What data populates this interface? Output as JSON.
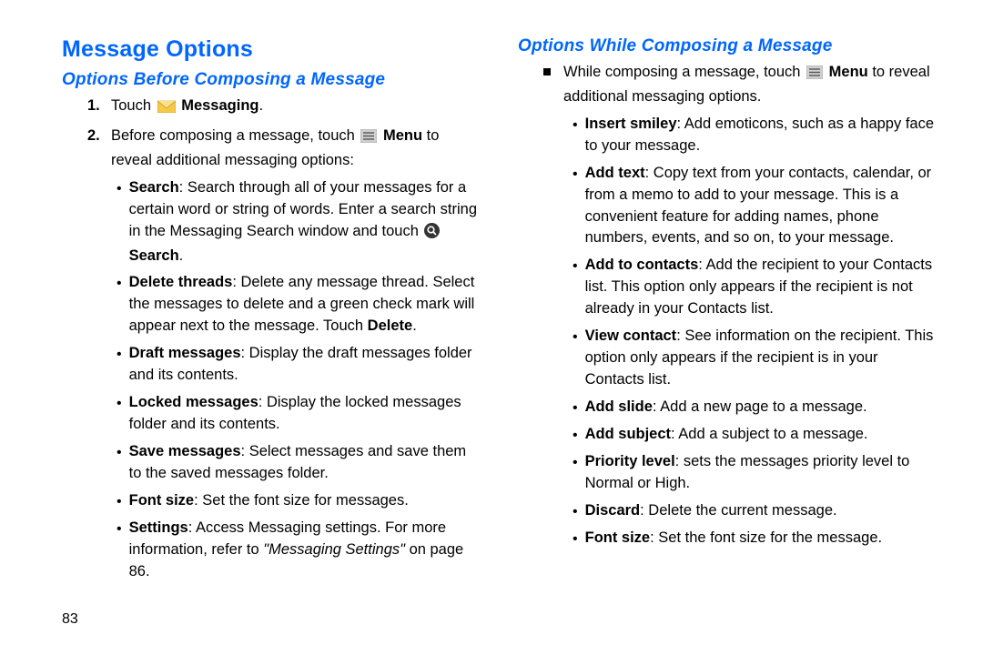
{
  "page_number": "83",
  "left": {
    "title": "Message Options",
    "subtitle": "Options Before Composing a Message",
    "step1_a": "Touch ",
    "step1_b": " Messaging",
    "step1_c": ".",
    "step2_a": "Before composing a message, touch ",
    "step2_b": " Menu",
    "step2_c": " to reveal additional messaging options:",
    "b1_t": "Search",
    "b1_a": ": Search through all of your messages for a certain word or string of words. Enter a search string in the Messaging Search window and touch ",
    "b1_b": " Search",
    "b1_c": ".",
    "b2_t": "Delete threads",
    "b2_a": ": Delete any message thread. Select the messages to delete and a green check mark will appear next to the message. Touch ",
    "b2_b": "Delete",
    "b2_c": ".",
    "b3_t": "Draft messages",
    "b3_a": ": Display the draft messages folder and its contents.",
    "b4_t": "Locked messages",
    "b4_a": ": Display the locked messages folder and its contents.",
    "b5_t": "Save messages",
    "b5_a": ": Select messages and save them to the saved messages folder.",
    "b6_t": "Font size",
    "b6_a": ": Set the font size for messages.",
    "b7_t": "Settings",
    "b7_a": ": Access Messaging settings. For more information, refer to ",
    "b7_b": "\"Messaging Settings\"",
    "b7_c": " on page 86."
  },
  "right": {
    "subtitle": "Options While Composing a Message",
    "lead_a": "While composing a message, touch ",
    "lead_b": " Menu",
    "lead_c": " to reveal additional messaging options.",
    "b1_t": "Insert smiley",
    "b1_a": ": Add emoticons, such as a happy face to your message.",
    "b2_t": "Add text",
    "b2_a": ": Copy text from your contacts, calendar, or from a memo to add to your message. This is a convenient feature for adding names, phone numbers, events, and so on, to your message.",
    "b3_t": "Add to contacts",
    "b3_a": ": Add the recipient to your Contacts list. This option only appears if the recipient is not already in your Contacts list.",
    "b4_t": "View contact",
    "b4_a": ": See information on the recipient. This option only appears if the recipient is in your Contacts list.",
    "b5_t": "Add slide",
    "b5_a": ": Add a new page to a message.",
    "b6_t": "Add subject",
    "b6_a": ": Add a subject to a message.",
    "b7_t": "Priority level",
    "b7_a": ": sets the messages priority level to Normal or High.",
    "b8_t": "Discard",
    "b8_a": ": Delete the current message.",
    "b9_t": "Font size",
    "b9_a": ": Set the font size for the message."
  }
}
